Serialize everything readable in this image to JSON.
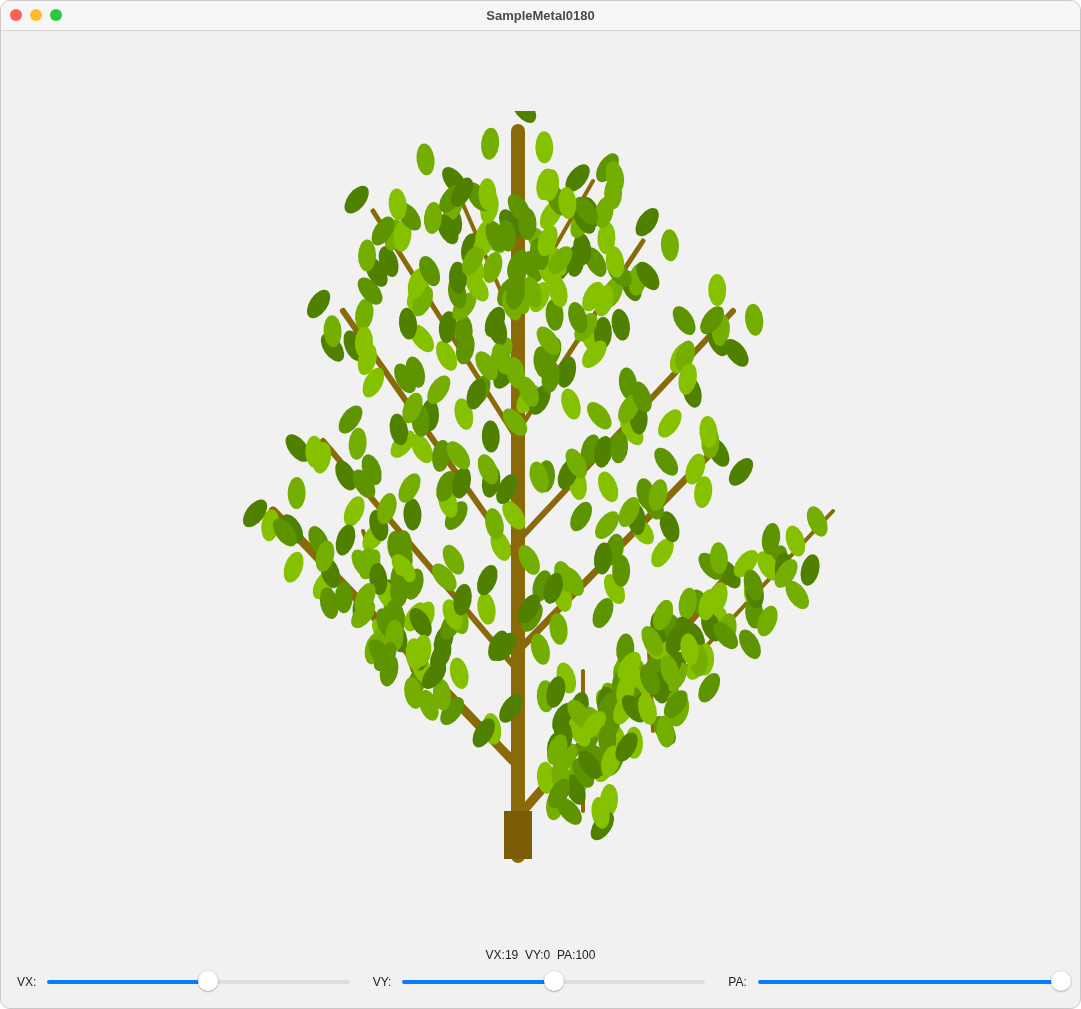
{
  "window": {
    "title": "SampleMetal0180"
  },
  "readout": "VX:19  VY:0  PA:100",
  "sliders": [
    {
      "label": "VX:",
      "level": 0.53
    },
    {
      "label": "VY:",
      "level": 0.5
    },
    {
      "label": "PA:",
      "level": 1.0
    }
  ]
}
